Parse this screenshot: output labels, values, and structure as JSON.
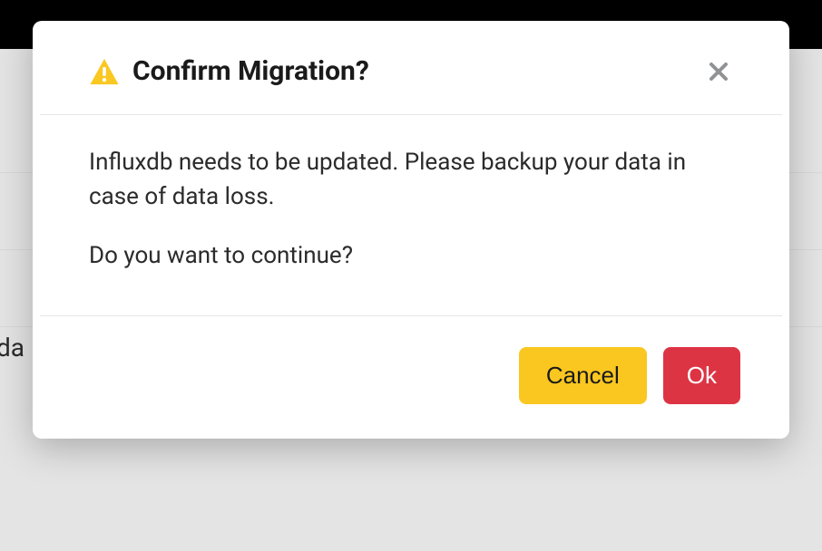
{
  "modal": {
    "title": "Confirm Migration?",
    "body_line1": "Influxdb needs to be updated. Please backup your data in case of data loss.",
    "body_line2": "Do you want to continue?",
    "cancel_label": "Cancel",
    "ok_label": "Ok"
  },
  "background": {
    "partial_text": "oda"
  },
  "colors": {
    "cancel_bg": "#fac720",
    "ok_bg": "#dd3444",
    "warning_icon": "#fac822"
  }
}
